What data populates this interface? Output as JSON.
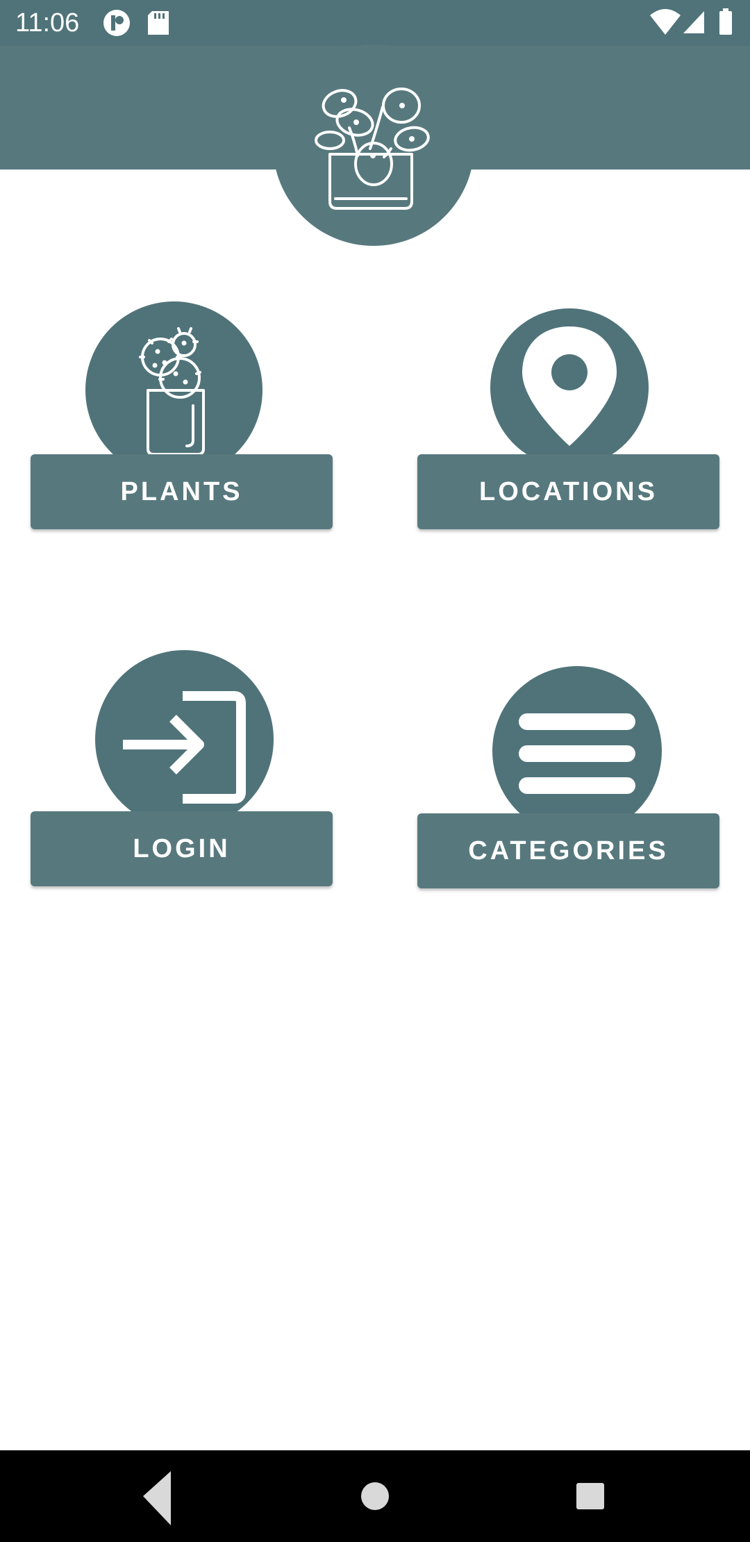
{
  "status_bar": {
    "time": "11:06",
    "left_icons": [
      "app-notification-icon",
      "sd-card-icon"
    ],
    "right_icons": [
      "wifi-icon",
      "cell-signal-icon",
      "battery-icon"
    ]
  },
  "header": {
    "logo_icon": "potted-plant-icon",
    "color": "#57797e"
  },
  "tiles": [
    {
      "label": "PLANTS",
      "icon": "cactus-pot-icon"
    },
    {
      "label": "LOCATIONS",
      "icon": "location-pin-icon"
    },
    {
      "label": "LOGIN",
      "icon": "login-icon"
    },
    {
      "label": "CATEGORIES",
      "icon": "menu-lines-icon"
    }
  ],
  "nav_bar": {
    "buttons": [
      "back-icon",
      "home-icon",
      "recents-icon"
    ]
  },
  "colors": {
    "primary": "#57797e",
    "primary_dark": "#4f7379",
    "background": "#ffffff"
  }
}
